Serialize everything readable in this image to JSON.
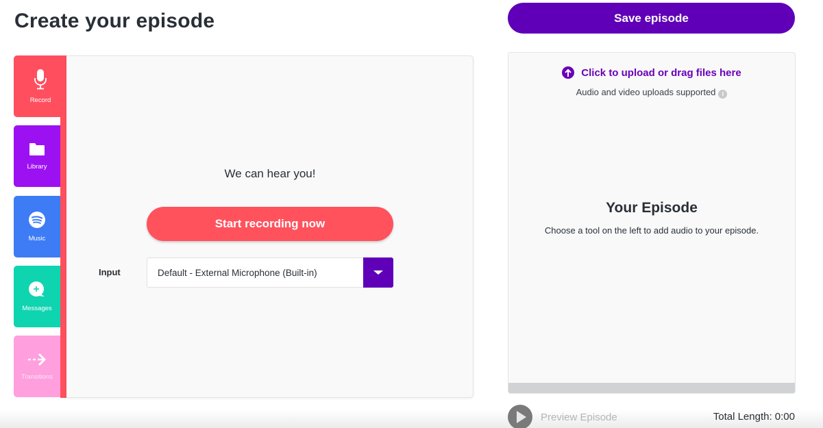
{
  "header": {
    "title": "Create your episode",
    "save_label": "Save episode"
  },
  "tools": [
    {
      "label": "Record",
      "icon": "microphone-icon",
      "color": "#ff4f5e"
    },
    {
      "label": "Library",
      "icon": "folder-icon",
      "color": "#9c11f2"
    },
    {
      "label": "Music",
      "icon": "spotify-icon",
      "color": "#3d7cf5"
    },
    {
      "label": "Messages",
      "icon": "message-add-icon",
      "color": "#0fd4b0"
    },
    {
      "label": "Transitions",
      "icon": "dashed-arrow-icon",
      "color": "#ff9fde"
    }
  ],
  "record": {
    "status": "We can hear you!",
    "start_label": "Start recording now",
    "input_label": "Input",
    "input_value": "Default - External Microphone (Built-in)"
  },
  "episode": {
    "upload_label": "Click to upload or drag files here",
    "upload_sub": "Audio and video uploads supported",
    "title": "Your Episode",
    "subtitle": "Choose a tool on the left to add audio to your episode."
  },
  "footer": {
    "preview_label": "Preview Episode",
    "total_length": "Total Length: 0:00"
  },
  "colors": {
    "accent": "#5f00b8",
    "record": "#ff525d"
  }
}
